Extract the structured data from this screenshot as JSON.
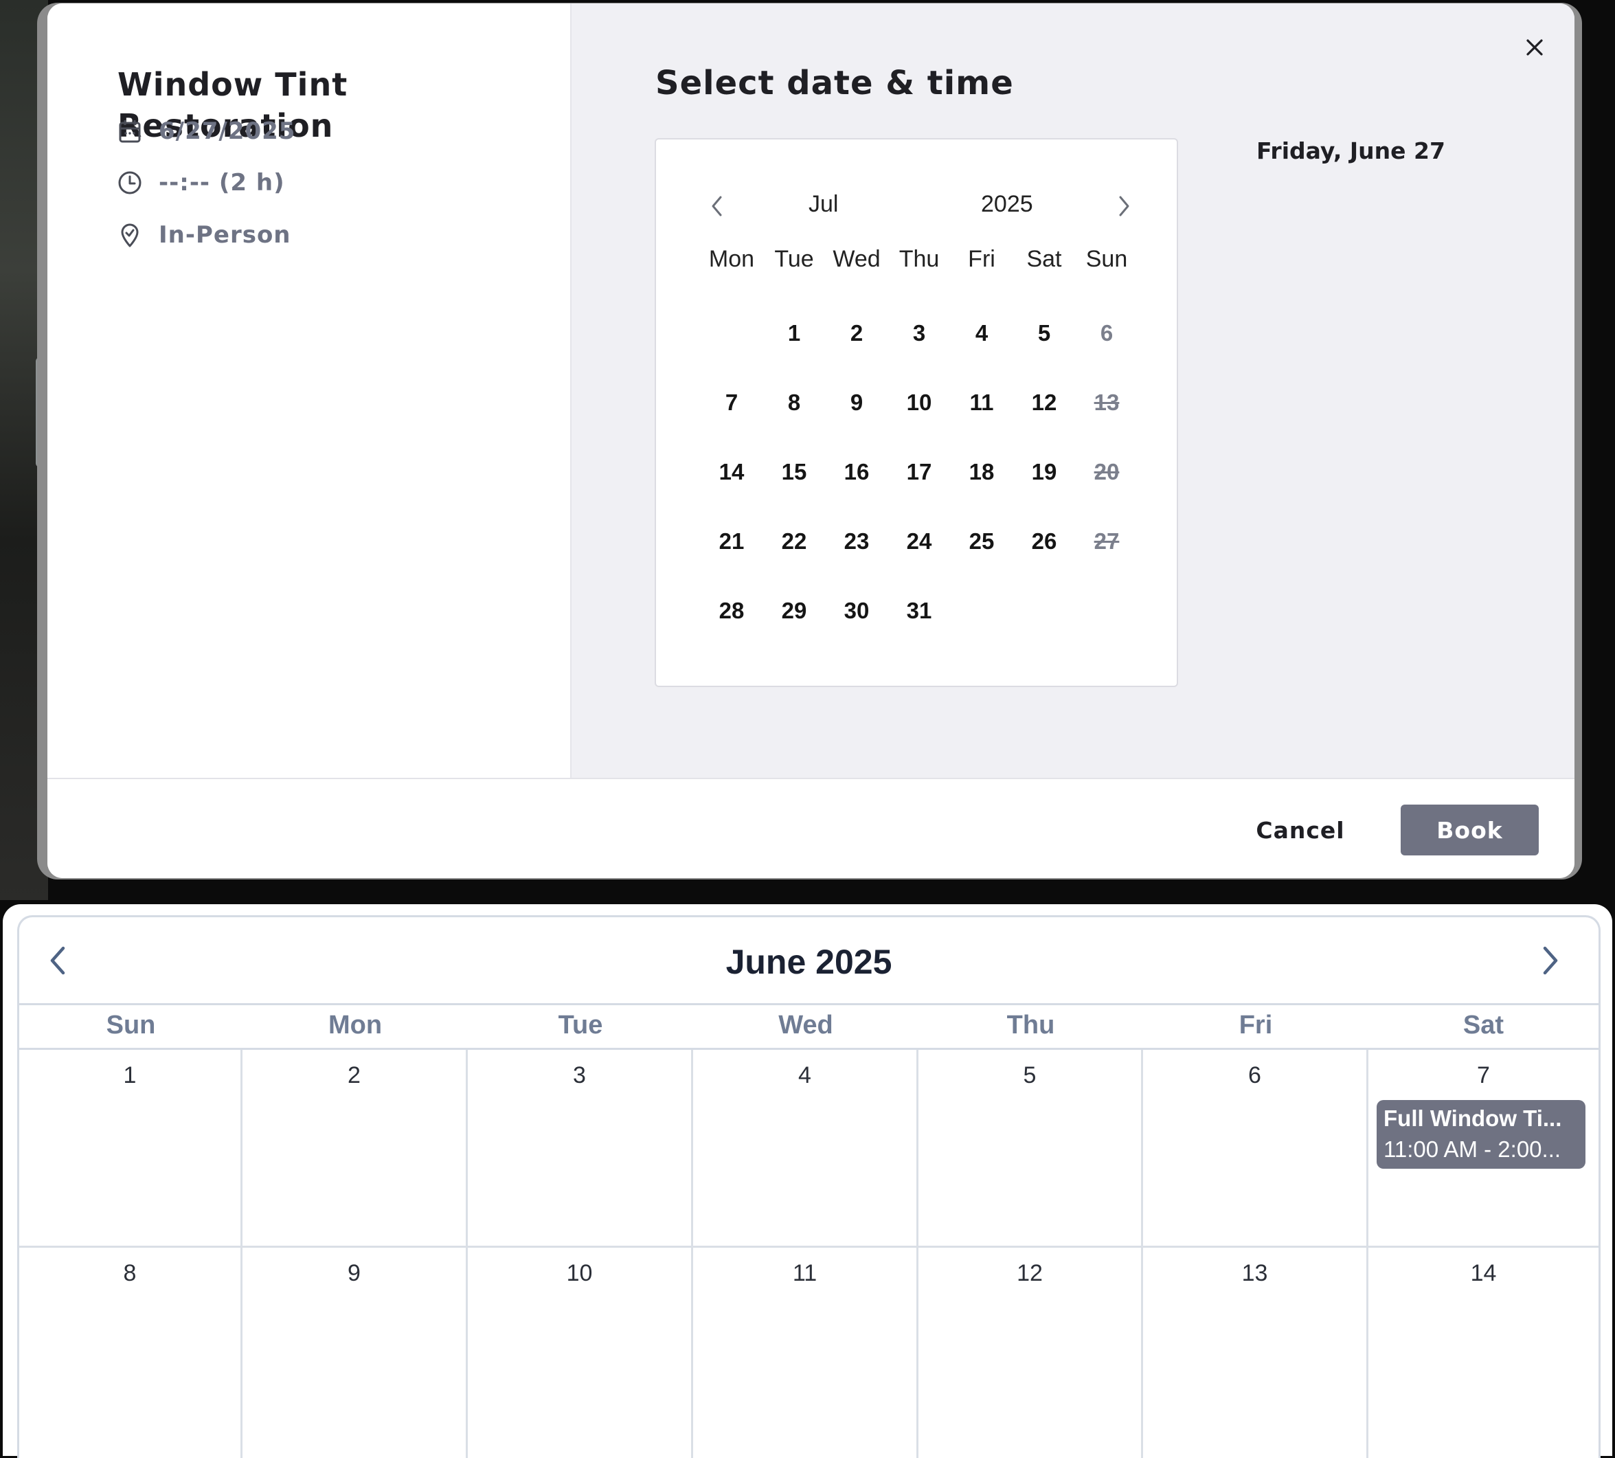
{
  "booking_modal": {
    "service_title": "Window Tint Restoration",
    "date": "6/27/2025",
    "time": "--:-- (2 h)",
    "location_type": "In-Person",
    "heading": "Select date & time",
    "selected_date_label": "Friday, June 27",
    "cancel_label": "Cancel",
    "book_label": "Book",
    "icons": {
      "date": "calendar-icon",
      "time": "clock-icon",
      "location": "location-pin-icon",
      "close": "close-icon"
    }
  },
  "mini_calendar": {
    "month": "Jul",
    "year": "2025",
    "weekdays": [
      "Mon",
      "Tue",
      "Wed",
      "Thu",
      "Fri",
      "Sat",
      "Sun"
    ],
    "weeks": [
      [
        "",
        "1",
        "2",
        "3",
        "4",
        "5",
        "6"
      ],
      [
        "7",
        "8",
        "9",
        "10",
        "11",
        "12",
        "13"
      ],
      [
        "14",
        "15",
        "16",
        "17",
        "18",
        "19",
        "20"
      ],
      [
        "21",
        "22",
        "23",
        "24",
        "25",
        "26",
        "27"
      ],
      [
        "28",
        "29",
        "30",
        "31",
        "",
        "",
        ""
      ]
    ],
    "muted_days": [
      "6"
    ],
    "strikethrough_days": [
      "13",
      "20",
      "27"
    ]
  },
  "month_calendar": {
    "title": "June 2025",
    "weekdays": [
      "Sun",
      "Mon",
      "Tue",
      "Wed",
      "Thu",
      "Fri",
      "Sat"
    ],
    "weeks": [
      [
        "1",
        "2",
        "3",
        "4",
        "5",
        "6",
        "7"
      ],
      [
        "8",
        "9",
        "10",
        "11",
        "12",
        "13",
        "14"
      ]
    ],
    "events": [
      {
        "day": "7",
        "title": "Full Window Ti...",
        "time": "11:00 AM - 2:00..."
      }
    ]
  },
  "colors": {
    "accent": "#6f7282",
    "panel_bg": "#f0f0f4",
    "muted_text": "#6e7384",
    "weekday_header": "#6f7c94",
    "grid_line": "#dadfe6"
  }
}
